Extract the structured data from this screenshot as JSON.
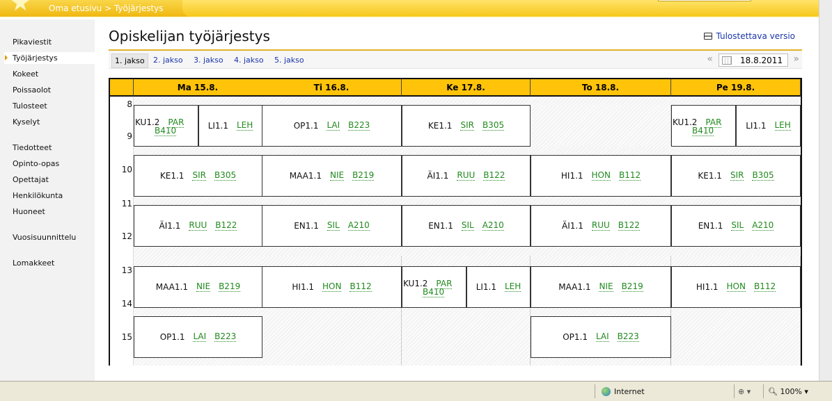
{
  "breadcrumb": "Oma etusivu > Työjärjestys",
  "sidebar": {
    "items": [
      {
        "label": "Pikaviestit",
        "active": false
      },
      {
        "label": "Työjärjestys",
        "active": true
      },
      {
        "label": "Kokeet",
        "active": false
      },
      {
        "label": "Poissaolot",
        "active": false
      },
      {
        "label": "Tulosteet",
        "active": false
      },
      {
        "label": "Kyselyt",
        "active": false
      },
      {
        "label": "Tiedotteet",
        "active": false
      },
      {
        "label": "Opinto-opas",
        "active": false
      },
      {
        "label": "Opettajat",
        "active": false
      },
      {
        "label": "Henkilökunta",
        "active": false
      },
      {
        "label": "Huoneet",
        "active": false
      },
      {
        "label": "Vuosisuunnittelu",
        "active": false
      },
      {
        "label": "Lomakkeet",
        "active": false
      }
    ]
  },
  "page": {
    "title": "Opiskelijan työjärjestys",
    "print_label": "Tulostettava versio"
  },
  "periods": [
    "1. jakso",
    "2. jakso",
    "3. jakso",
    "4. jakso",
    "5. jakso"
  ],
  "selected_period": "1. jakso",
  "date": "18.8.2011",
  "date_prev": "«",
  "date_next": "»",
  "days": [
    "Ma 15.8.",
    "Ti 16.8.",
    "Ke 17.8.",
    "To 18.8.",
    "Pe 19.8."
  ],
  "hours": [
    "8",
    "9",
    "10",
    "11",
    "12",
    "13",
    "14",
    "15"
  ],
  "lessons": [
    {
      "day": 0,
      "slot": 0,
      "part": "left",
      "course": "KU1.2",
      "teacher": "PAR",
      "room": "B410"
    },
    {
      "day": 0,
      "slot": 0,
      "part": "right",
      "course": "LI1.1",
      "teacher": "LEH",
      "room": ""
    },
    {
      "day": 1,
      "slot": 0,
      "part": "full",
      "course": "OP1.1",
      "teacher": "LAI",
      "room": "B223"
    },
    {
      "day": 2,
      "slot": 0,
      "part": "full",
      "course": "KE1.1",
      "teacher": "SIR",
      "room": "B305"
    },
    {
      "day": 4,
      "slot": 0,
      "part": "left",
      "course": "KU1.2",
      "teacher": "PAR",
      "room": "B410"
    },
    {
      "day": 4,
      "slot": 0,
      "part": "right",
      "course": "LI1.1",
      "teacher": "LEH",
      "room": ""
    },
    {
      "day": 0,
      "slot": 1,
      "part": "full",
      "course": "KE1.1",
      "teacher": "SIR",
      "room": "B305"
    },
    {
      "day": 1,
      "slot": 1,
      "part": "full",
      "course": "MAA1.1",
      "teacher": "NIE",
      "room": "B219"
    },
    {
      "day": 2,
      "slot": 1,
      "part": "full",
      "course": "ÄI1.1",
      "teacher": "RUU",
      "room": "B122"
    },
    {
      "day": 3,
      "slot": 1,
      "part": "full",
      "course": "HI1.1",
      "teacher": "HON",
      "room": "B112"
    },
    {
      "day": 4,
      "slot": 1,
      "part": "full",
      "course": "KE1.1",
      "teacher": "SIR",
      "room": "B305"
    },
    {
      "day": 0,
      "slot": 2,
      "part": "full",
      "course": "ÄI1.1",
      "teacher": "RUU",
      "room": "B122"
    },
    {
      "day": 1,
      "slot": 2,
      "part": "full",
      "course": "EN1.1",
      "teacher": "SIL",
      "room": "A210"
    },
    {
      "day": 2,
      "slot": 2,
      "part": "full",
      "course": "EN1.1",
      "teacher": "SIL",
      "room": "A210"
    },
    {
      "day": 3,
      "slot": 2,
      "part": "full",
      "course": "ÄI1.1",
      "teacher": "RUU",
      "room": "B122"
    },
    {
      "day": 4,
      "slot": 2,
      "part": "full",
      "course": "EN1.1",
      "teacher": "SIL",
      "room": "A210"
    },
    {
      "day": 0,
      "slot": 3,
      "part": "full",
      "course": "MAA1.1",
      "teacher": "NIE",
      "room": "B219"
    },
    {
      "day": 1,
      "slot": 3,
      "part": "full",
      "course": "HI1.1",
      "teacher": "HON",
      "room": "B112"
    },
    {
      "day": 2,
      "slot": 3,
      "part": "left",
      "course": "KU1.2",
      "teacher": "PAR",
      "room": "B410"
    },
    {
      "day": 2,
      "slot": 3,
      "part": "right",
      "course": "LI1.1",
      "teacher": "LEH",
      "room": ""
    },
    {
      "day": 3,
      "slot": 3,
      "part": "full",
      "course": "MAA1.1",
      "teacher": "NIE",
      "room": "B219"
    },
    {
      "day": 4,
      "slot": 3,
      "part": "full",
      "course": "HI1.1",
      "teacher": "HON",
      "room": "B112"
    },
    {
      "day": 0,
      "slot": 4,
      "part": "full",
      "course": "OP1.1",
      "teacher": "LAI",
      "room": "B223"
    },
    {
      "day": 3,
      "slot": 4,
      "part": "full",
      "course": "OP1.1",
      "teacher": "LAI",
      "room": "B223"
    }
  ],
  "statusbar": {
    "zone": "Internet",
    "zoom": "100%"
  },
  "colors": {
    "header_yellow": "#ffc30a",
    "link_blue": "#1a35a8",
    "teacher_green": "#228a1e"
  },
  "icons": [
    "star-logo-icon",
    "printer-icon",
    "calendar-icon",
    "globe-icon",
    "lock-icon",
    "zoom-icon"
  ]
}
